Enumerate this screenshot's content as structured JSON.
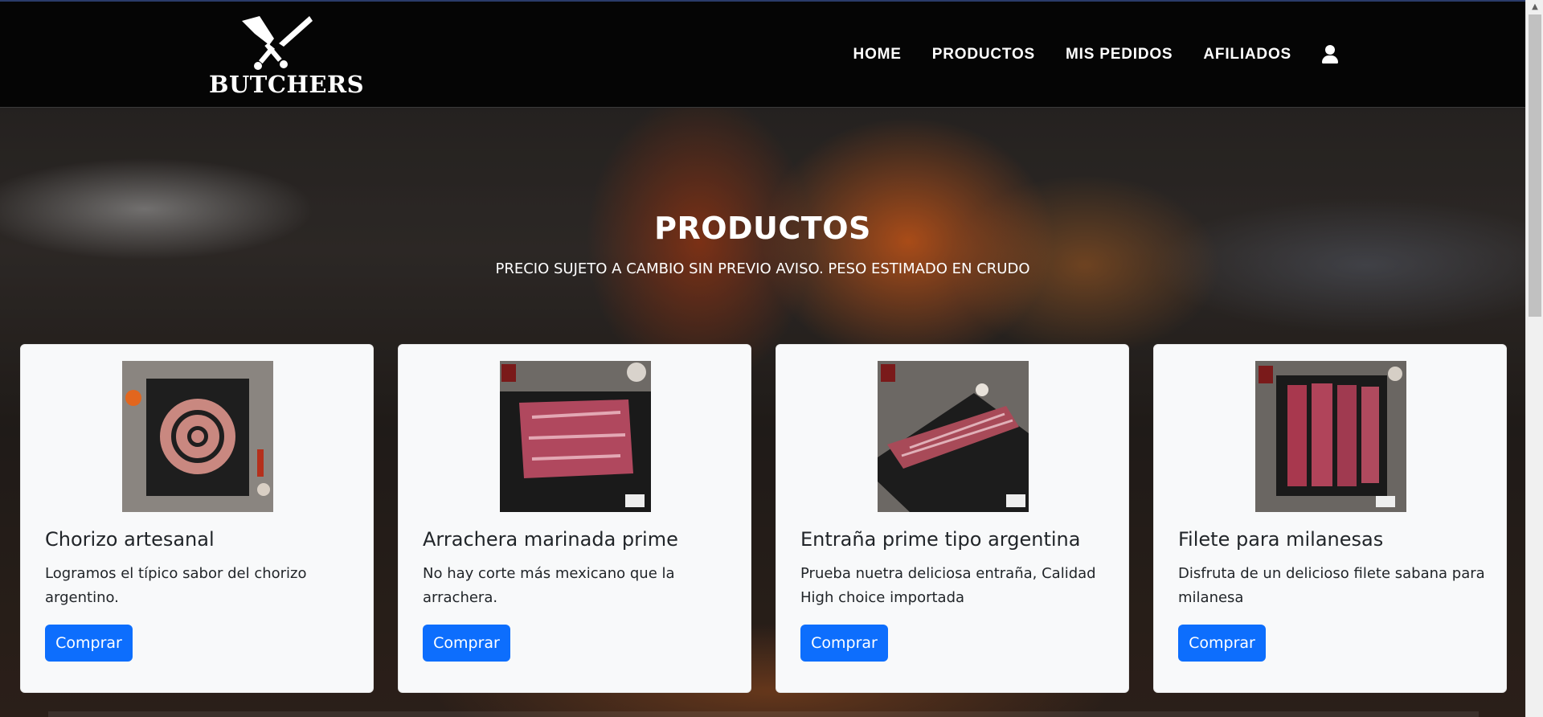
{
  "brand": {
    "name": "BUTCHERS",
    "logo_icon": "crossed-cleavers-icon"
  },
  "nav": {
    "items": [
      "HOME",
      "PRODUCTOS",
      "MIS PEDIDOS",
      "AFILIADOS"
    ],
    "user_icon": "user-icon"
  },
  "hero": {
    "title": "PRODUCTOS",
    "subtitle": "PRECIO SUJETO A CAMBIO SIN PREVIO AVISO. PESO ESTIMADO EN CRUDO"
  },
  "products": [
    {
      "title": "Chorizo artesanal",
      "description": "Logramos el típico sabor del chorizo argentino.",
      "button": "Comprar"
    },
    {
      "title": "Arrachera marinada prime",
      "description": "No hay corte más mexicano que la arrachera.",
      "button": "Comprar"
    },
    {
      "title": "Entraña prime tipo argentina",
      "description": "Prueba nuetra deliciosa entraña, Calidad High choice importada",
      "button": "Comprar"
    },
    {
      "title": "Filete para milanesas",
      "description": "Disfruta de un delicioso filete sabana para milanesa",
      "button": "Comprar"
    }
  ],
  "colors": {
    "navbar": "#050505",
    "card": "#f8f9fa",
    "button": "#0d6efd"
  }
}
